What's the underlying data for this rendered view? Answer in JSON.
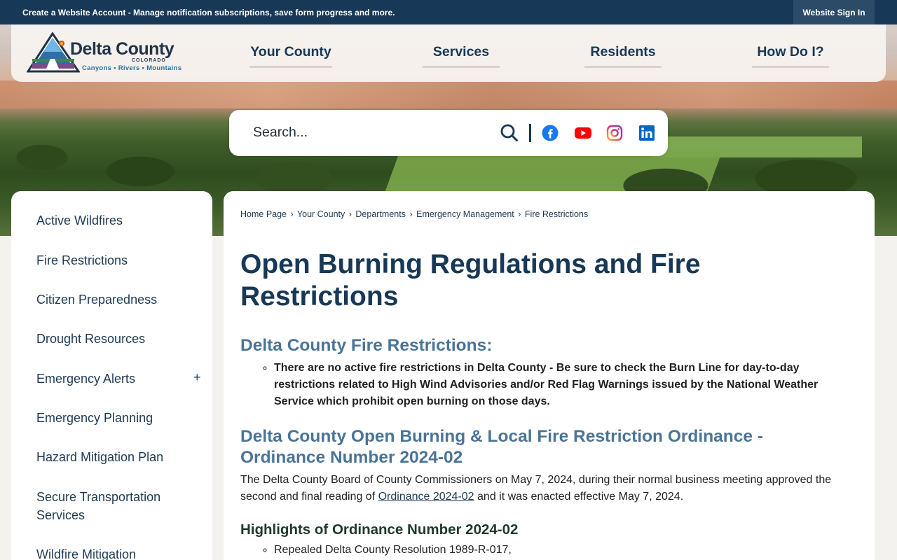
{
  "topbar": {
    "account_link": "Create a Website Account",
    "account_text": " - Manage notification subscriptions, save form progress and more.",
    "signin": "Website Sign In"
  },
  "logo": {
    "name": "Delta County",
    "state": "COLORADO",
    "tagline": "Canyons • Rivers • Mountains"
  },
  "nav": [
    "Your County",
    "Services",
    "Residents",
    "How Do I?"
  ],
  "search": {
    "placeholder": "Search..."
  },
  "social": [
    "facebook-icon",
    "youtube-icon",
    "instagram-icon",
    "linkedin-icon"
  ],
  "sidebar": {
    "items": [
      "Active Wildfires",
      "Fire Restrictions",
      "Citizen Preparedness",
      "Drought Resources",
      "Emergency Alerts",
      "Emergency Planning",
      "Hazard Mitigation Plan",
      "Secure Transportation Services",
      "Wildfire Mitigation"
    ],
    "expand_symbol": "+"
  },
  "breadcrumb": [
    "Home Page",
    "Your County",
    "Departments",
    "Emergency Management",
    "Fire Restrictions"
  ],
  "breadcrumb_sep": "›",
  "page": {
    "title": "Open Burning Regulations and Fire Restrictions",
    "section1_heading": "Delta County Fire Restrictions:",
    "section1_bullet": "There are no active fire restrictions in Delta County - Be sure to check the Burn Line for day-to-day restrictions related to High Wind Advisories and/or Red Flag Warnings issued by the National Weather Service which prohibit open burning on those days.",
    "section2_heading": "Delta County Open Burning & Local Fire Restriction Ordinance - Ordinance Number 2024-02",
    "para_before": "The Delta County Board of County Commissioners on May 7, 2024, during their normal business meeting approved the second and final reading of ",
    "para_link": "Ordinance 2024-02",
    "para_after": " and it was enacted effective May 7, 2024.",
    "section3_heading": "Highlights of Ordinance Number 2024-02",
    "section3_bullet": "Repealed Delta County Resolution 1989-R-017,"
  },
  "colors": {
    "navy": "#173856",
    "heading_blue": "#4a7497",
    "facebook": "#1877f2",
    "youtube": "#ff0000",
    "linkedin": "#0a66c2"
  }
}
